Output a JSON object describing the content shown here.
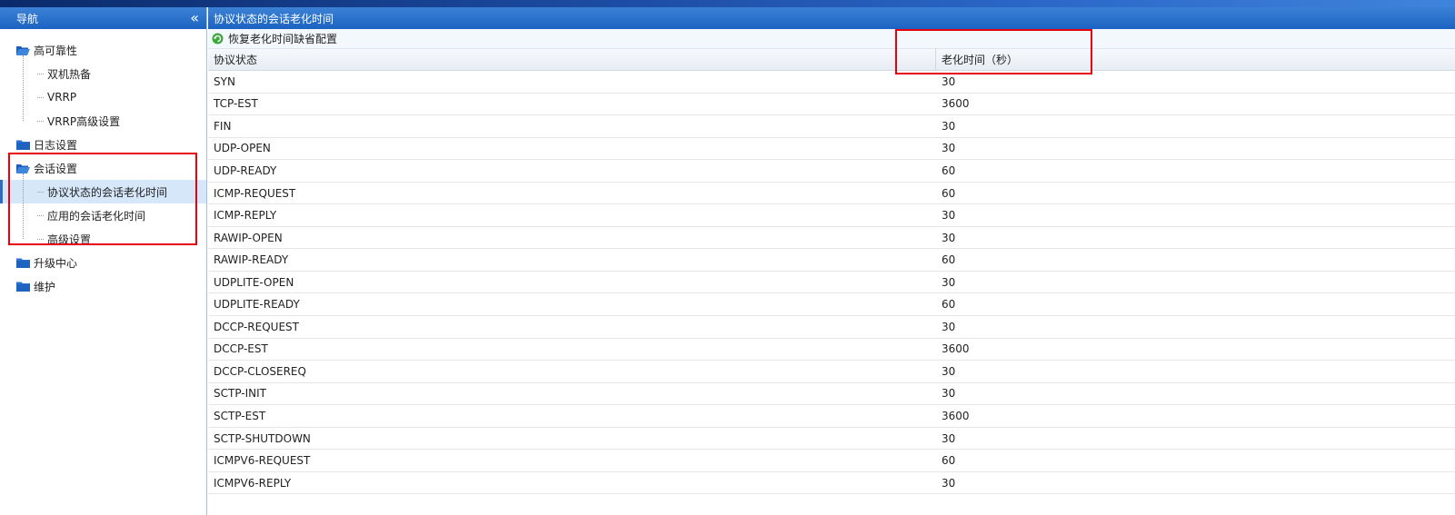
{
  "sidebar": {
    "title": "导航",
    "collapse_glyph": "«",
    "tree": [
      {
        "label": "高可靠性",
        "icon": "folder-open-icon",
        "children": [
          "双机热备",
          "VRRP",
          "VRRP高级设置"
        ]
      },
      {
        "label": "日志设置",
        "icon": "folder-icon",
        "children": []
      },
      {
        "label": "会话设置",
        "icon": "folder-open-icon",
        "children": [
          "协议状态的会话老化时间",
          "应用的会话老化时间",
          "高级设置"
        ],
        "selected_child": 0
      },
      {
        "label": "升级中心",
        "icon": "folder-icon",
        "children": []
      },
      {
        "label": "维护",
        "icon": "folder-icon",
        "children": []
      }
    ]
  },
  "main": {
    "title": "协议状态的会话老化时间",
    "toolbar": {
      "restore_label": "恢复老化时间缺省配置",
      "restore_icon": "restore-icon"
    },
    "table": {
      "headers": [
        "协议状态",
        "老化时间（秒）"
      ],
      "rows": [
        [
          "SYN",
          "30"
        ],
        [
          "TCP-EST",
          "3600"
        ],
        [
          "FIN",
          "30"
        ],
        [
          "UDP-OPEN",
          "30"
        ],
        [
          "UDP-READY",
          "60"
        ],
        [
          "ICMP-REQUEST",
          "60"
        ],
        [
          "ICMP-REPLY",
          "30"
        ],
        [
          "RAWIP-OPEN",
          "30"
        ],
        [
          "RAWIP-READY",
          "60"
        ],
        [
          "UDPLITE-OPEN",
          "30"
        ],
        [
          "UDPLITE-READY",
          "60"
        ],
        [
          "DCCP-REQUEST",
          "30"
        ],
        [
          "DCCP-EST",
          "3600"
        ],
        [
          "DCCP-CLOSEREQ",
          "30"
        ],
        [
          "SCTP-INIT",
          "30"
        ],
        [
          "SCTP-EST",
          "3600"
        ],
        [
          "SCTP-SHUTDOWN",
          "30"
        ],
        [
          "ICMPV6-REQUEST",
          "60"
        ],
        [
          "ICMPV6-REPLY",
          "30"
        ]
      ]
    }
  },
  "colors": {
    "header_blue": "#1c63c2",
    "highlight_red": "#e8000c",
    "selected_bg": "#d6e7fa"
  }
}
